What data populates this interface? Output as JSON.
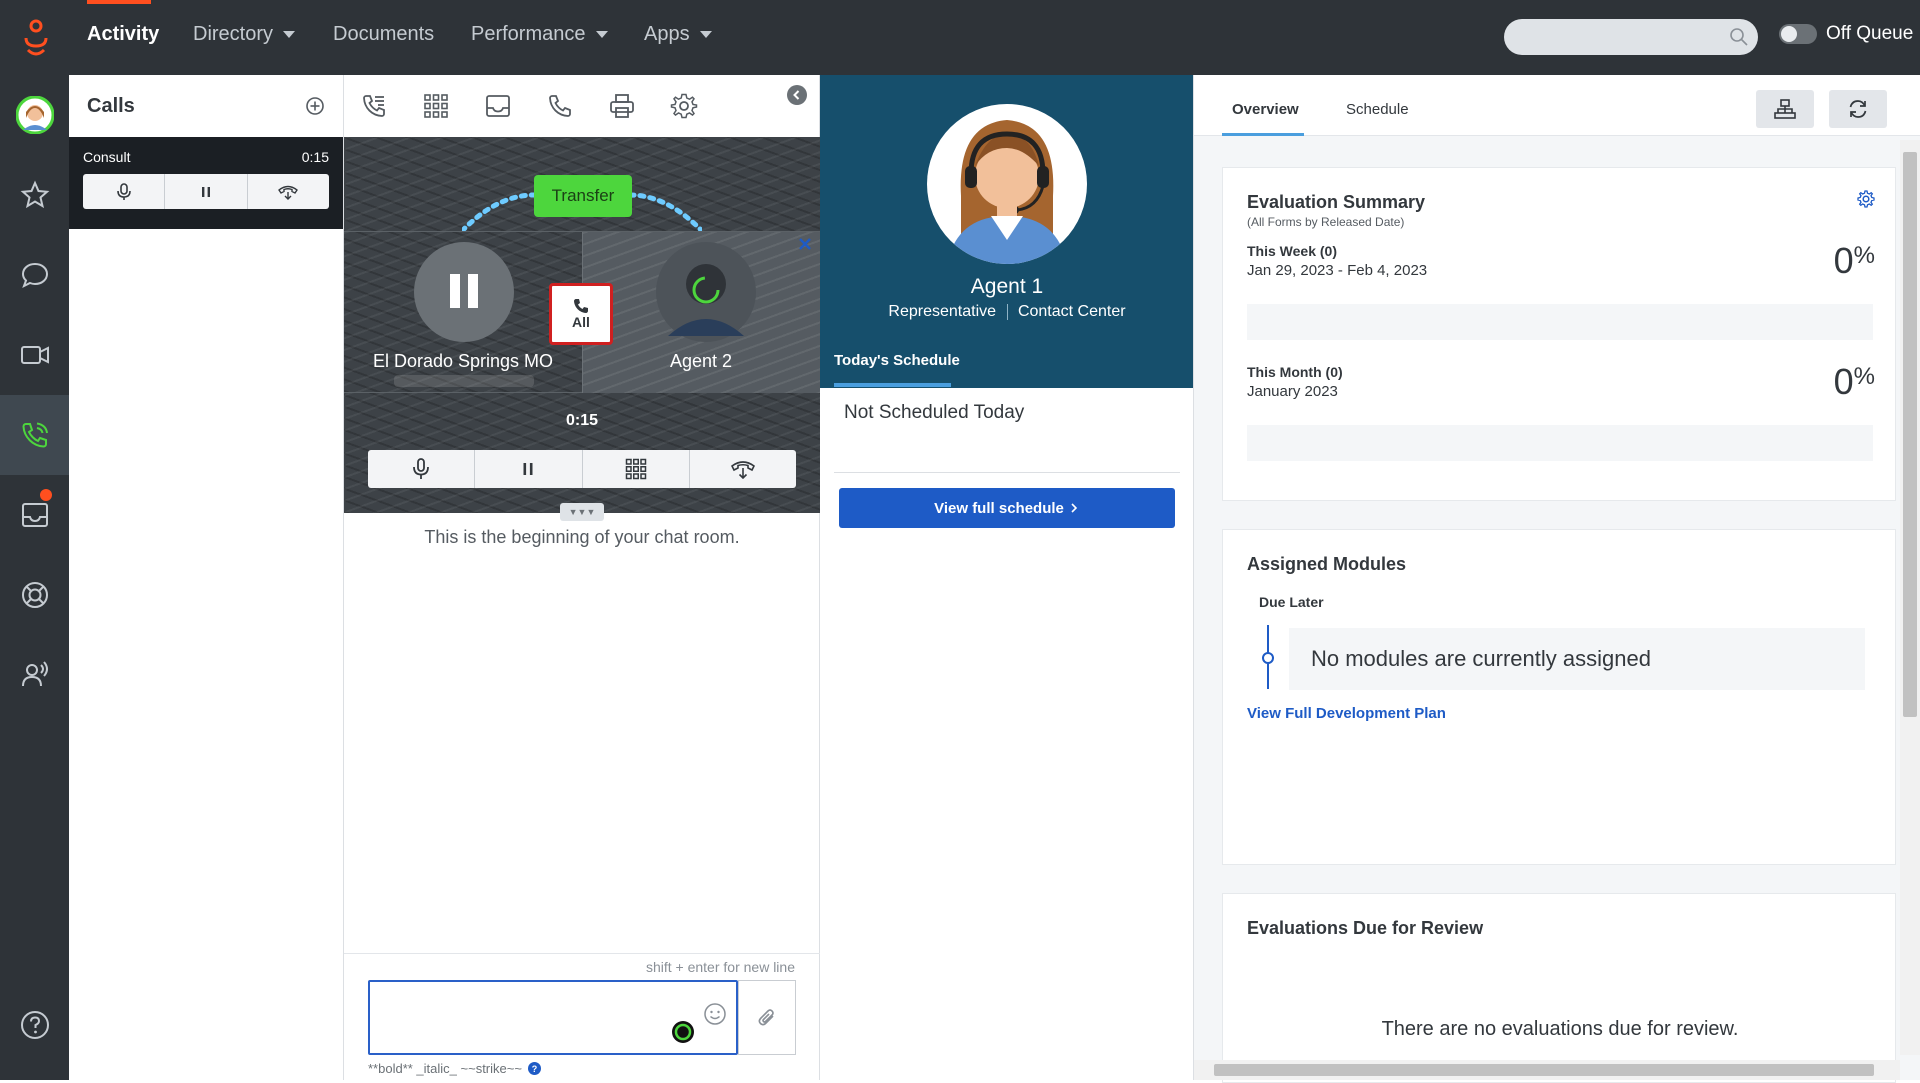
{
  "nav": {
    "items": [
      {
        "label": "Activity",
        "active": true
      },
      {
        "label": "Directory",
        "dropdown": true
      },
      {
        "label": "Documents"
      },
      {
        "label": "Performance",
        "dropdown": true
      },
      {
        "label": "Apps",
        "dropdown": true
      }
    ],
    "search_value": "",
    "queue_label": "Off Queue"
  },
  "sidebar": {
    "icons": [
      "avatar",
      "star-icon",
      "chat-bubble-icon",
      "video-icon",
      "phone-wave-icon",
      "inbox-icon",
      "support-icon",
      "people-speaking-icon",
      "help-icon"
    ],
    "selected": "phone-wave-icon"
  },
  "calls": {
    "title": "Calls",
    "item": {
      "label": "Consult",
      "time": "0:15"
    }
  },
  "call": {
    "transfer_label": "Transfer",
    "party1": "El Dorado Springs MO",
    "party2": "Agent 2",
    "all_label": "All",
    "timer": "0:15",
    "chat_begin": "This is the beginning of your chat room.",
    "hint": "shift + enter for new line",
    "message_value": "",
    "format_hint": "**bold** _italic_ ~~strike~~"
  },
  "profile": {
    "name": "Agent 1",
    "role": "Representative",
    "department": "Contact Center",
    "tab": "Today's Schedule",
    "not_scheduled": "Not Scheduled Today",
    "view_schedule": "View full schedule"
  },
  "right": {
    "tabs": [
      {
        "label": "Overview",
        "active": true
      },
      {
        "label": "Schedule"
      }
    ],
    "eval": {
      "title": "Evaluation Summary",
      "subtitle": "(All Forms by Released Date)",
      "week_label": "This Week (0)",
      "week_range": "Jan 29, 2023 - Feb 4, 2023",
      "week_pct": "0",
      "month_label": "This Month (0)",
      "month_range": "January 2023",
      "month_pct": "0",
      "pct_sign": "%"
    },
    "modules": {
      "title": "Assigned Modules",
      "due_label": "Due Later",
      "empty": "No modules are currently assigned",
      "link": "View Full Development Plan"
    },
    "review": {
      "title": "Evaluations Due for Review",
      "empty": "There are no evaluations due for review."
    }
  },
  "colors": {
    "accent": "#ff4f1f",
    "primary_button": "#1e5bc6",
    "profile_header": "#164f6c",
    "transfer": "#4dd63d"
  }
}
